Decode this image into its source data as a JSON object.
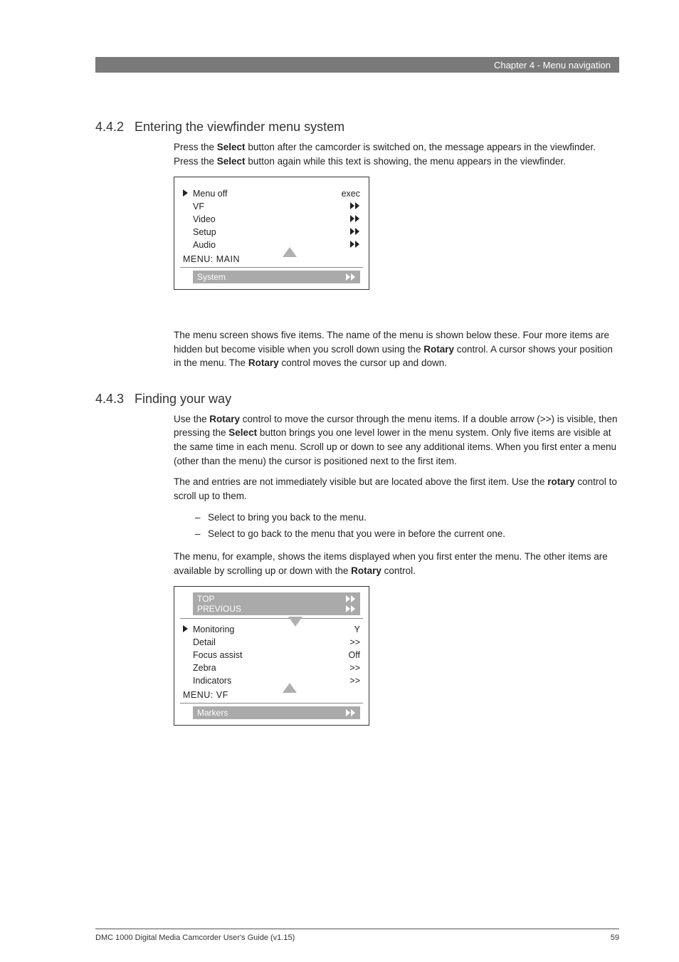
{
  "header": {
    "chapter": "Chapter 4 - Menu navigation"
  },
  "section1": {
    "num": "4.4.2",
    "title": "Entering the viewfinder menu system",
    "p1a": "Press the ",
    "p1b": "Select",
    "p1c": " button after the camcorder is switched on, the message ",
    "p1d": " appears in the viewfinder. Press the ",
    "p1e": "Select",
    "p1f": " button again while this text is showing, the ",
    "p1g": " menu appears in the viewfinder.",
    "menu": {
      "items": [
        {
          "label": "Menu off",
          "val": "exec",
          "cursor": true,
          "ff": false
        },
        {
          "label": "VF",
          "val": "",
          "ff": true
        },
        {
          "label": "Video",
          "val": "",
          "ff": true
        },
        {
          "label": "Setup",
          "val": "",
          "ff": true
        },
        {
          "label": "Audio",
          "val": "",
          "ff": true
        }
      ],
      "menu_label": "MENU:  MAIN",
      "below": {
        "label": "System"
      }
    },
    "p2a": "The ",
    "p2b": " menu screen shows five items. The name of the menu is shown below these. Four more items are hidden but become visible when you scroll down using the ",
    "p2c": "Rotary",
    "p2d": " control. A cursor shows your position in the menu. The ",
    "p2e": "Rotary",
    "p2f": " control moves the cursor up and down."
  },
  "section2": {
    "num": "4.4.3",
    "title": "Finding your way",
    "p1a": "Use the ",
    "p1b": "Rotary",
    "p1c": " control to move the cursor through the menu items. If a double arrow (>>) is visible, then pressing the ",
    "p1d": "Select",
    "p1e": " button brings you one level lower in the menu system. Only five items are visible at the same time in each menu. Scroll up or down to see any additional items. When you first enter a menu (other than the ",
    "p1f": " menu) the cursor is positioned next to the first item.",
    "p2a": "The ",
    "p2b": " and ",
    "p2c": " entries are not immediately visible but are located above the first item. Use the ",
    "p2d": "rotary",
    "p2e": " control to scroll up to them.",
    "bullets": [
      {
        "a": "Select ",
        "b": " to bring you back to the ",
        "c": " menu."
      },
      {
        "a": "Select ",
        "b": " to go back to the menu that you were in before the current one."
      }
    ],
    "p3a": "The ",
    "p3b": " menu, for example, shows the items displayed when you first enter the menu. The other items are available by scrolling up or down with the ",
    "p3c": "Rotary",
    "p3d": " control.",
    "menu": {
      "above": [
        {
          "label": "TOP"
        },
        {
          "label": "PREVIOUS"
        }
      ],
      "items": [
        {
          "label": "Monitoring",
          "val": "Y",
          "cursor": true
        },
        {
          "label": "Detail",
          "val": ">>"
        },
        {
          "label": "Focus assist",
          "val": "Off"
        },
        {
          "label": "Zebra",
          "val": ">>"
        },
        {
          "label": "Indicators",
          "val": ">>"
        }
      ],
      "menu_label": "MENU:  VF",
      "below": {
        "label": "Markers"
      }
    }
  },
  "footer": {
    "left": "DMC 1000 Digital Media Camcorder User's Guide (v1.15)",
    "right": "59"
  }
}
